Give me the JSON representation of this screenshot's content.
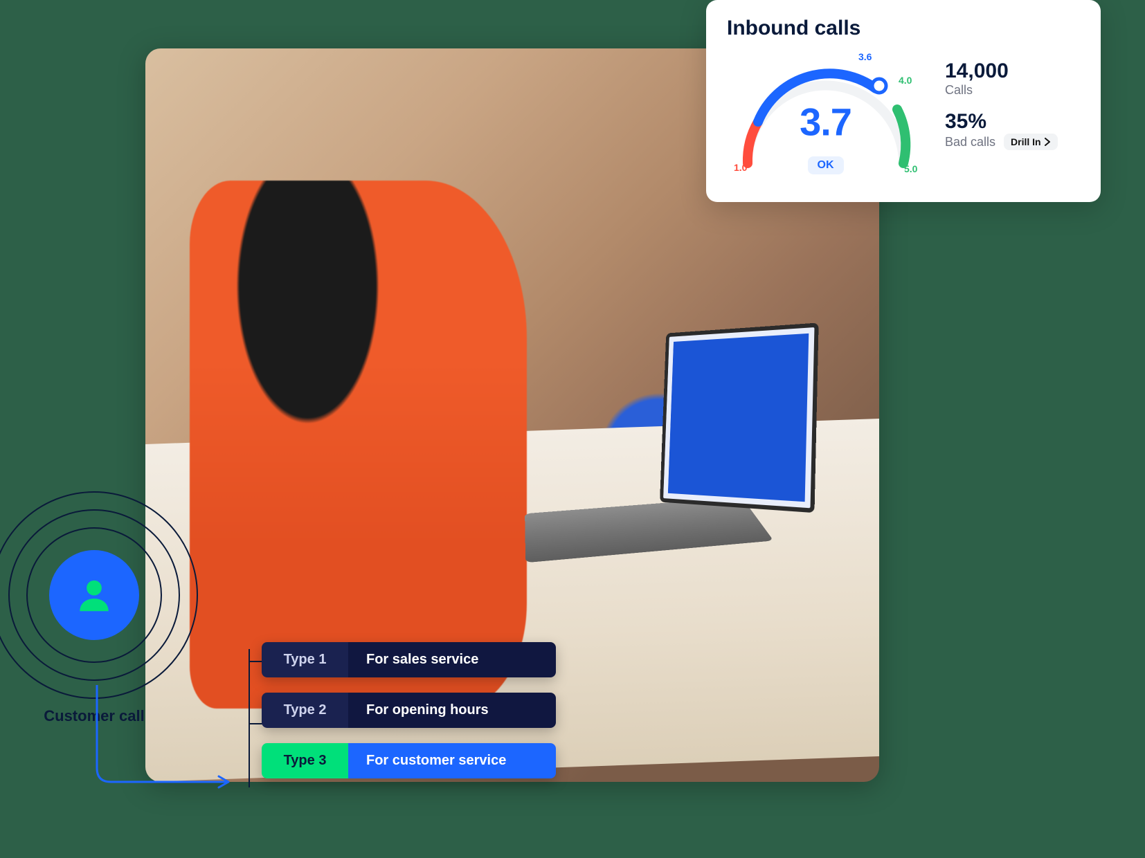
{
  "card": {
    "title": "Inbound calls",
    "gauge": {
      "value": "3.7",
      "badge": "OK",
      "ticks": {
        "t10": "1.0",
        "t36": "3.6",
        "t40": "4.0",
        "t50": "5.0"
      }
    },
    "stats": {
      "calls_value": "14,000",
      "calls_label": "Calls",
      "bad_value": "35%",
      "bad_label": "Bad calls",
      "drill_label": "Drill In"
    }
  },
  "call": {
    "label": "Customer call"
  },
  "types": [
    {
      "tag": "Type 1",
      "label": "For sales service",
      "variant": "dark"
    },
    {
      "tag": "Type 2",
      "label": "For opening hours",
      "variant": "dark"
    },
    {
      "tag": "Type 3",
      "label": "For customer service",
      "variant": "active"
    }
  ],
  "chart_data": {
    "type": "gauge",
    "title": "Inbound calls",
    "value": 3.7,
    "min": 1.0,
    "max": 5.0,
    "segments": [
      {
        "from": 1.0,
        "to": 3.6,
        "color": "#ff4d3d_to_#1c66ff",
        "meaning": "low→ok"
      },
      {
        "from": 3.6,
        "to": 4.0,
        "color": "#1c66ff_to_#2fbf71"
      },
      {
        "from": 4.0,
        "to": 5.0,
        "color": "#2fbf71"
      }
    ],
    "ticks": [
      1.0,
      3.6,
      4.0,
      5.0
    ],
    "status_badge": "OK",
    "aux_metrics": [
      {
        "name": "Calls",
        "value": 14000,
        "format": "###,###"
      },
      {
        "name": "Bad calls",
        "value": 35,
        "unit": "%"
      }
    ]
  }
}
